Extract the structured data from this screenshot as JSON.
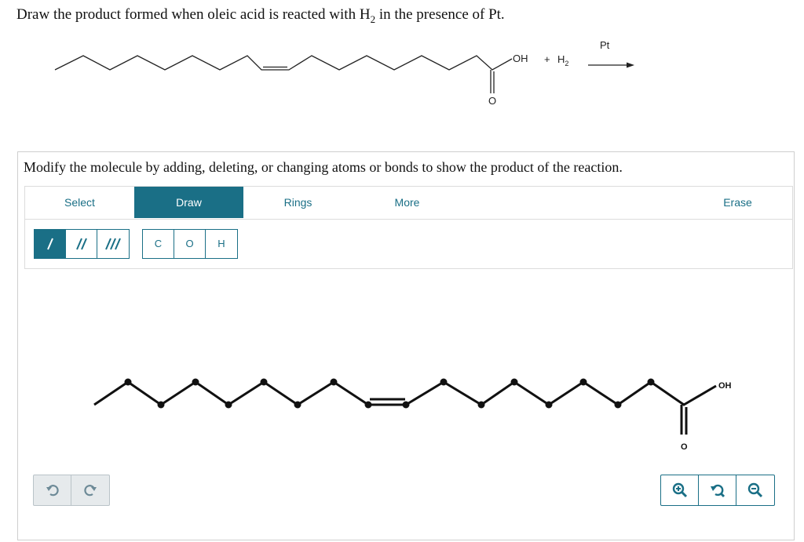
{
  "question": {
    "prefix": "Draw the product formed when oleic acid is reacted with H",
    "subscript": "2",
    "suffix": " in the presence of Pt."
  },
  "reaction": {
    "oh_label": "OH",
    "o_label": "O",
    "plus": "+",
    "h2_label": "H",
    "h2_subscript": "2",
    "catalyst": "Pt"
  },
  "instruction": "Modify the molecule by adding, deleting, or changing atoms or bonds to show the product of the reaction.",
  "tabs": [
    {
      "label": "Select"
    },
    {
      "label": "Draw"
    },
    {
      "label": "Rings"
    },
    {
      "label": "More"
    },
    {
      "label": "Erase"
    }
  ],
  "active_tab": "Draw",
  "bond_tools": [
    "single-bond",
    "double-bond",
    "triple-bond"
  ],
  "active_bond": "single-bond",
  "atom_tools": [
    "C",
    "O",
    "H"
  ],
  "canvas": {
    "oh_label": "OH",
    "o_label": "O"
  },
  "colors": {
    "accent": "#1a6f86",
    "border": "#cfcfcf"
  },
  "icons": [
    "undo-icon",
    "redo-icon",
    "zoom-in-icon",
    "zoom-reset-icon",
    "zoom-out-icon"
  ]
}
